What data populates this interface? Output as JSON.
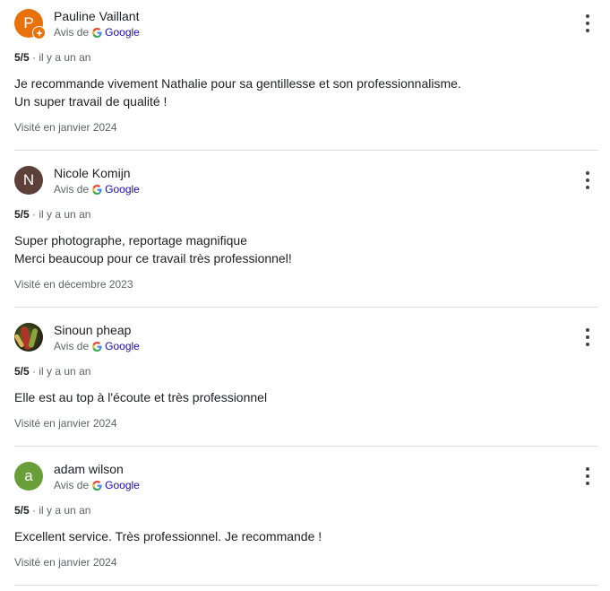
{
  "source_label": "Avis de",
  "source_brand": "Google",
  "reviews": [
    {
      "author": "Pauline Vaillant",
      "avatar_letter": "P",
      "avatar_color": "#e8710a",
      "local_guide_badge": true,
      "rating": "5/5",
      "time": "il y a un an",
      "text": [
        "Je recommande vivement Nathalie pour sa gentillesse et son professionnalisme.",
        "Un super travail de qualité !"
      ],
      "visited": "Visité en janvier 2024"
    },
    {
      "author": "Nicole Komijn",
      "avatar_letter": "N",
      "avatar_color": "#5d4037",
      "local_guide_badge": false,
      "rating": "5/5",
      "time": "il y a un an",
      "text": [
        "Super photographe, reportage magnifique",
        "Merci beaucoup pour ce travail très professionnel!"
      ],
      "visited": "Visité en décembre 2023"
    },
    {
      "author": "Sinoun pheap",
      "avatar_letter": "",
      "avatar_color": "#3d4a1c",
      "local_guide_badge": false,
      "rating": "5/5",
      "time": "il y a un an",
      "text": [
        "Elle est au top à l'écoute et très professionnel"
      ],
      "visited": "Visité en janvier 2024"
    },
    {
      "author": "adam wilson",
      "avatar_letter": "a",
      "avatar_color": "#689f38",
      "local_guide_badge": false,
      "rating": "5/5",
      "time": "il y a un an",
      "text": [
        "Excellent service. Très professionnel. Je recommande !"
      ],
      "visited": "Visité en janvier 2024"
    }
  ],
  "icons": {
    "more": "more-vert-icon",
    "google": "google-g-icon",
    "badge": "local-guide-star-icon"
  }
}
